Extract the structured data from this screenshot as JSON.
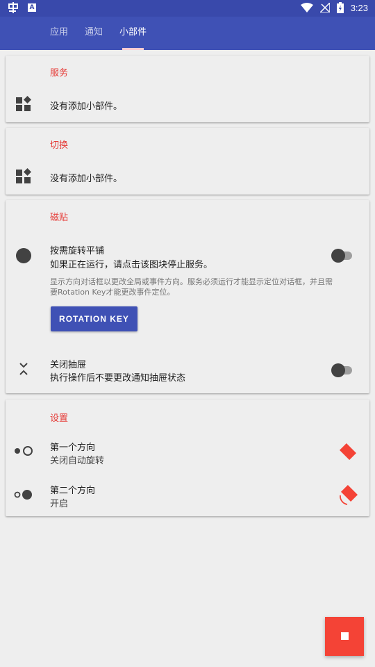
{
  "status_bar": {
    "time": "3:23",
    "badge": "A"
  },
  "tabs": [
    {
      "label": "应用"
    },
    {
      "label": "通知"
    },
    {
      "label": "小部件"
    }
  ],
  "sections": {
    "services": {
      "title": "服务",
      "empty_text": "没有添加小部件。"
    },
    "toggles": {
      "title": "切换",
      "empty_text": "没有添加小部件。"
    },
    "tiles": {
      "title": "磁贴",
      "on_demand": {
        "title": "按需旋转平铺",
        "subtitle": "如果正在运行，请点击该图块停止服务。",
        "enabled": false
      },
      "hint_line1": "显示方向对话框以更改全局或事件方向。服务必须运行才能显示定位对话框，并且需",
      "hint_line2": "要Rotation Key才能更改事件定位。",
      "button_label": "ROTATION KEY",
      "close_drawer": {
        "title": "关闭抽屉",
        "subtitle": "执行操作后不要更改通知抽屉状态",
        "enabled": false
      }
    },
    "settings": {
      "title": "设置",
      "first_orientation": {
        "title": "第一个方向",
        "value": "关闭自动旋转"
      },
      "second_orientation": {
        "title": "第二个方向",
        "value": "开启"
      }
    }
  },
  "colors": {
    "primary": "#3f51b5",
    "accent": "#f44336",
    "section_title": "#e53935"
  }
}
